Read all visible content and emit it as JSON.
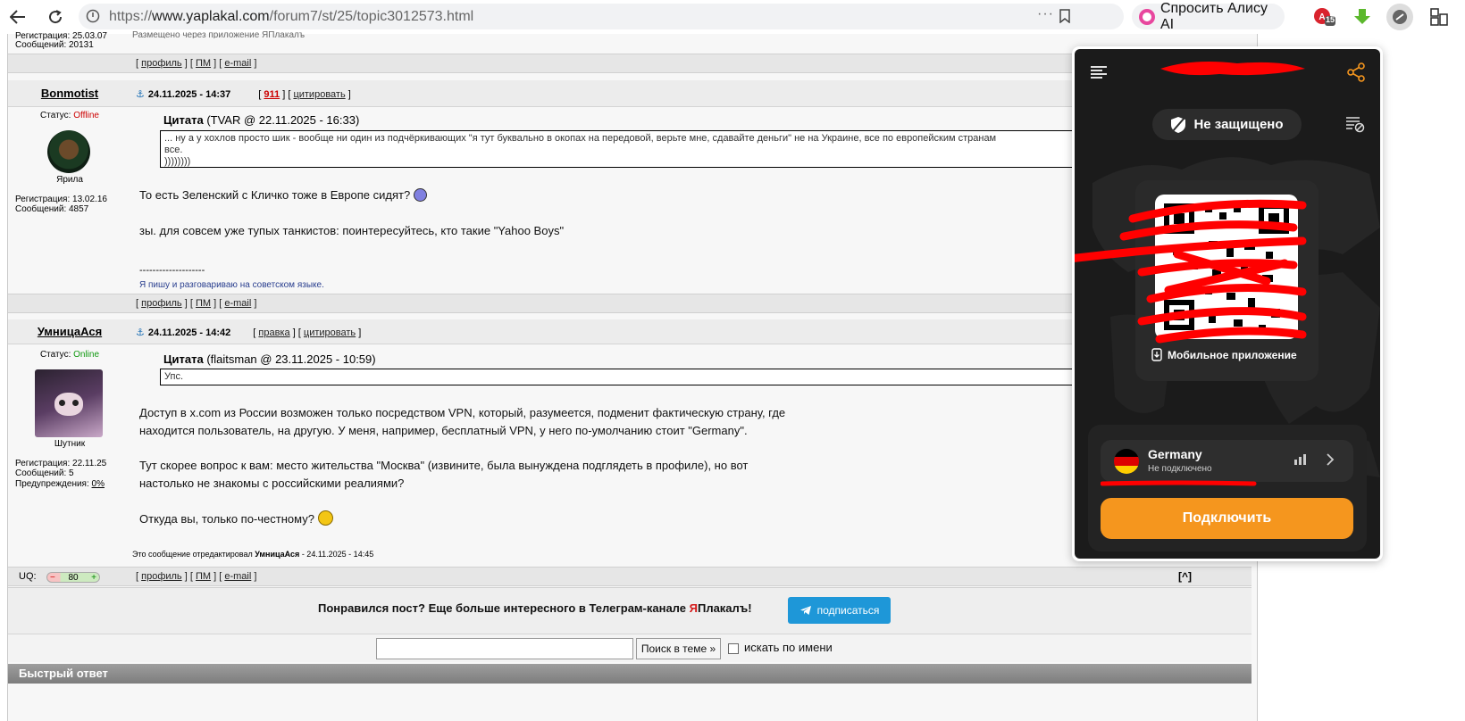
{
  "browser": {
    "url_prefix": "https://",
    "url_host": "www.yaplakal.com",
    "url_path": "/forum7/st/25/topic3012573.html",
    "menu_dots": "···",
    "alisa_label": "Спросить Алису AI",
    "ext_badge": "15"
  },
  "post_top": {
    "reg_text": "Регистрация: 25.03.07",
    "msgs_text": "Сообщений: 20131",
    "posted_via": "Размещено через приложение ЯПлакалъ"
  },
  "post_links": {
    "open": "[",
    "profile": "профиль",
    "pm": "ПМ",
    "email": "e-mail",
    "sep": "] [",
    "close": "]"
  },
  "post1": {
    "author": "Bonmotist",
    "status_label": "Статус:",
    "status": "Offline",
    "rank": "Ярила",
    "reg": "Регистрация: 13.02.16",
    "msgs": "Сообщений: 4857",
    "date": "24.11.2025 - 14:37",
    "rating": "911",
    "cite": "цитировать",
    "quote_label": "Цитата",
    "quote_src": "(TVAR @ 22.11.2025 - 16:33)",
    "quote_line1": "... ну а у хохлов просто шик - вообще ни один из подчёркивающих \"я тут буквально в окопах на передовой, верьте мне, сдавайте деньги\" не на Украине, все по европейским странам",
    "quote_line2": "все.",
    "quote_line3": "))))))))",
    "text1": "То есть Зеленский с Кличко тоже в Европе сидят?",
    "text2": "зы. для совсем уже тупых танкистов: поинтересуйтесь, кто такие \"Yahoo Boys\"",
    "sig_line": "--------------------",
    "sig_text": "Я пишу и разговариваю на советском языке."
  },
  "post2": {
    "author": "УмницаАся",
    "status_label": "Статус:",
    "status": "Online",
    "rank": "Шутник",
    "reg": "Регистрация: 22.11.25",
    "msgs": "Сообщений: 5",
    "warn_label": "Предупреждения:",
    "warn": "0%",
    "date": "24.11.2025 - 14:42",
    "edit": "правка",
    "cite": "цитировать",
    "quote_label": "Цитата",
    "quote_src": "(flaitsman @ 23.11.2025 - 10:59)",
    "quote_text": "Упс.",
    "p1a": "Доступ в x.com из России возможен только посредством VPN, который, разумеется, подменит фактическую страну, где",
    "p1b": "находится пользователь, на другую. У меня, например, бесплатный VPN, у него по-умолчанию стоит \"Germany\".",
    "p2a": "Тут скорее вопрос к вам: место жительства \"Москва\" (извините, была вынуждена подглядеть в профиле), но вот",
    "p2b": "настолько не знакомы с российскими реалиями?",
    "p3": "Откуда вы, только по-честному?",
    "edited_prefix": "Это сообщение отредактировал",
    "edited_by": "УмницаАся",
    "edited_suffix": "- 24.11.2025 - 14:45",
    "uq_label": "UQ:",
    "uq_minus": "−",
    "uq_value": "80",
    "uq_plus": "+",
    "to_top": "[^]"
  },
  "telegram": {
    "text_a": "Понравился пост? Еще больше интересного в Телеграм-канале ",
    "text_ya": "Я",
    "text_b": "Плакалъ!",
    "button": "подписаться"
  },
  "search": {
    "button": "Поиск в теме »",
    "checkbox_label": "искать по имени"
  },
  "quick_reply": "Быстрый ответ",
  "vpn": {
    "status": "Не защищено",
    "mobile_app": "Мобильное приложение",
    "country": "Germany",
    "conn_status": "Не подключено",
    "connect": "Подключить",
    "colors": {
      "accent": "#f5961e",
      "panel": "#1b1b1b",
      "redact": "#ff0000"
    }
  }
}
